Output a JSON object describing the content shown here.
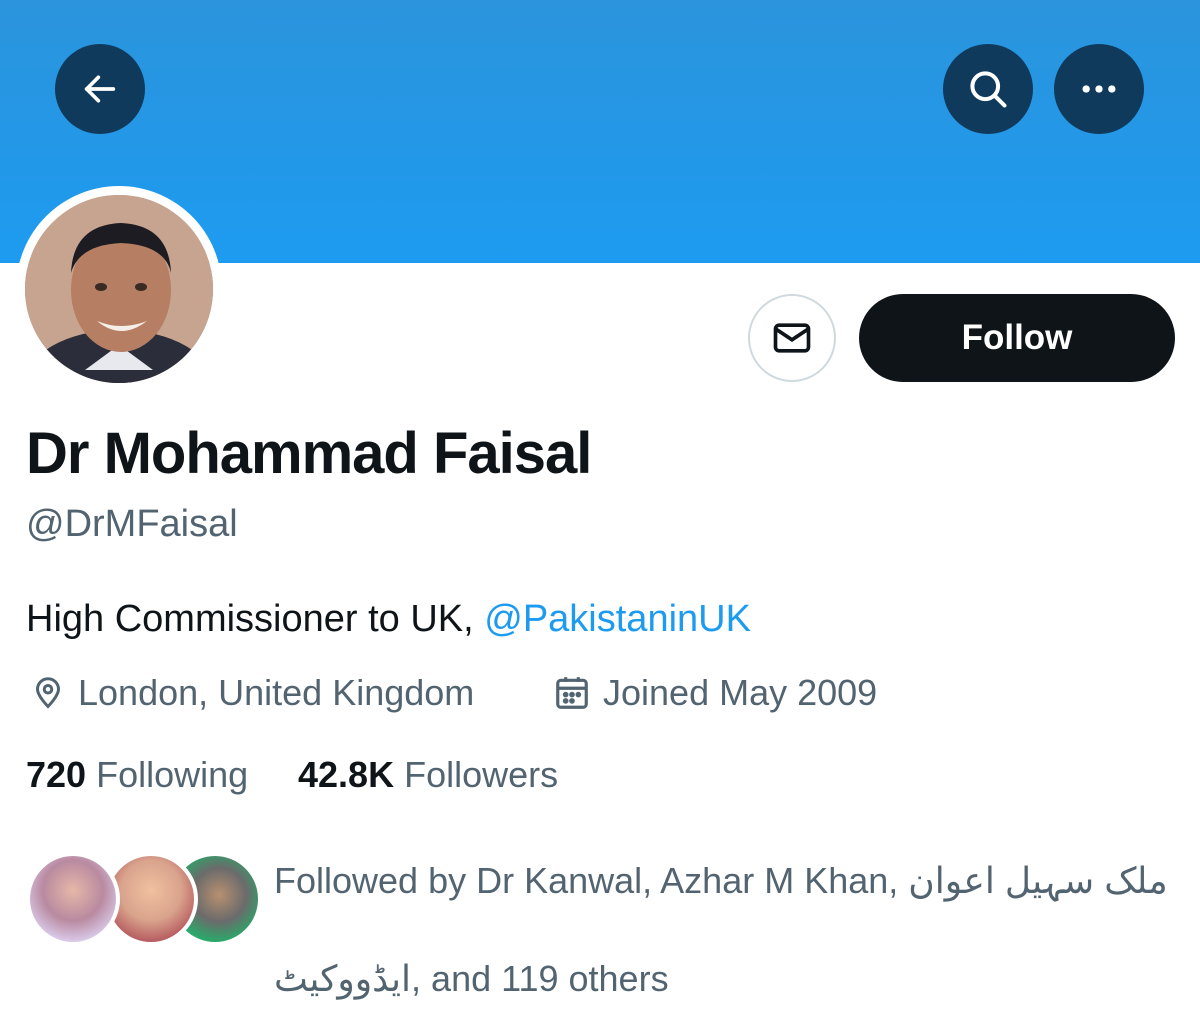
{
  "header": {
    "back_icon": "arrow-left-icon",
    "search_icon": "search-icon",
    "more_icon": "more-horizontal-icon",
    "banner_color": "#1d9bf0"
  },
  "profile": {
    "name": "Dr Mohammad Faisal",
    "handle": "@DrMFaisal",
    "bio_text": "High Commissioner to UK, ",
    "bio_link": "@PakistaninUK",
    "location": "London, United Kingdom",
    "joined": "Joined May 2009"
  },
  "actions": {
    "message_icon": "mail-icon",
    "follow_label": "Follow"
  },
  "stats": {
    "following_count": "720",
    "following_label": "Following",
    "followers_count": "42.8K",
    "followers_label": "Followers"
  },
  "followed_by": {
    "text": "Followed by Dr Kanwal, Azhar M Khan, ملک سہیل اعوان ایڈووکیٹ, and 119 others"
  },
  "colors": {
    "accent": "#1d9bf0",
    "text_primary": "#0f1419",
    "text_secondary": "#536471"
  }
}
